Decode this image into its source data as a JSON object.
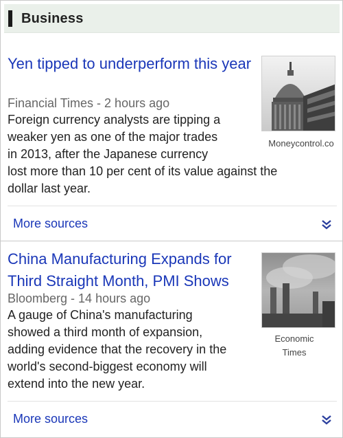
{
  "section": {
    "title": "Business"
  },
  "stories": [
    {
      "headline": "Yen tipped to underperform this year",
      "source": "Financial Times",
      "time": "2 hours ago",
      "snippet_lines": [
        "Foreign currency analysts are tipping a",
        "weaker yen as one of the major trades",
        "in 2013, after the Japanese currency"
      ],
      "snippet_tail": [
        "lost more than 10 per cent of its value against the",
        "dollar last year."
      ],
      "image_source": "Moneycontrol.co",
      "more_label": "More sources"
    },
    {
      "headline": "China Manufacturing Expands for Third Straight Month, PMI Shows",
      "source": "Bloomberg",
      "time": "14 hours ago",
      "snippet_lines": [
        "A gauge of China's manufacturing",
        "showed a third month of expansion,",
        "adding evidence that the recovery in the",
        "world's second-biggest economy will",
        "extend into the new year."
      ],
      "image_source": "Economic Times",
      "image_source_lines": [
        "Economic",
        "Times"
      ],
      "more_label": "More sources"
    }
  ],
  "separator": " - ",
  "icons": {
    "section_marker": "section-bar-icon",
    "expand": "double-chevron-down-icon"
  },
  "colors": {
    "link": "#1a37b8",
    "header_bg": "#eaf0ea",
    "meta": "#666666"
  }
}
